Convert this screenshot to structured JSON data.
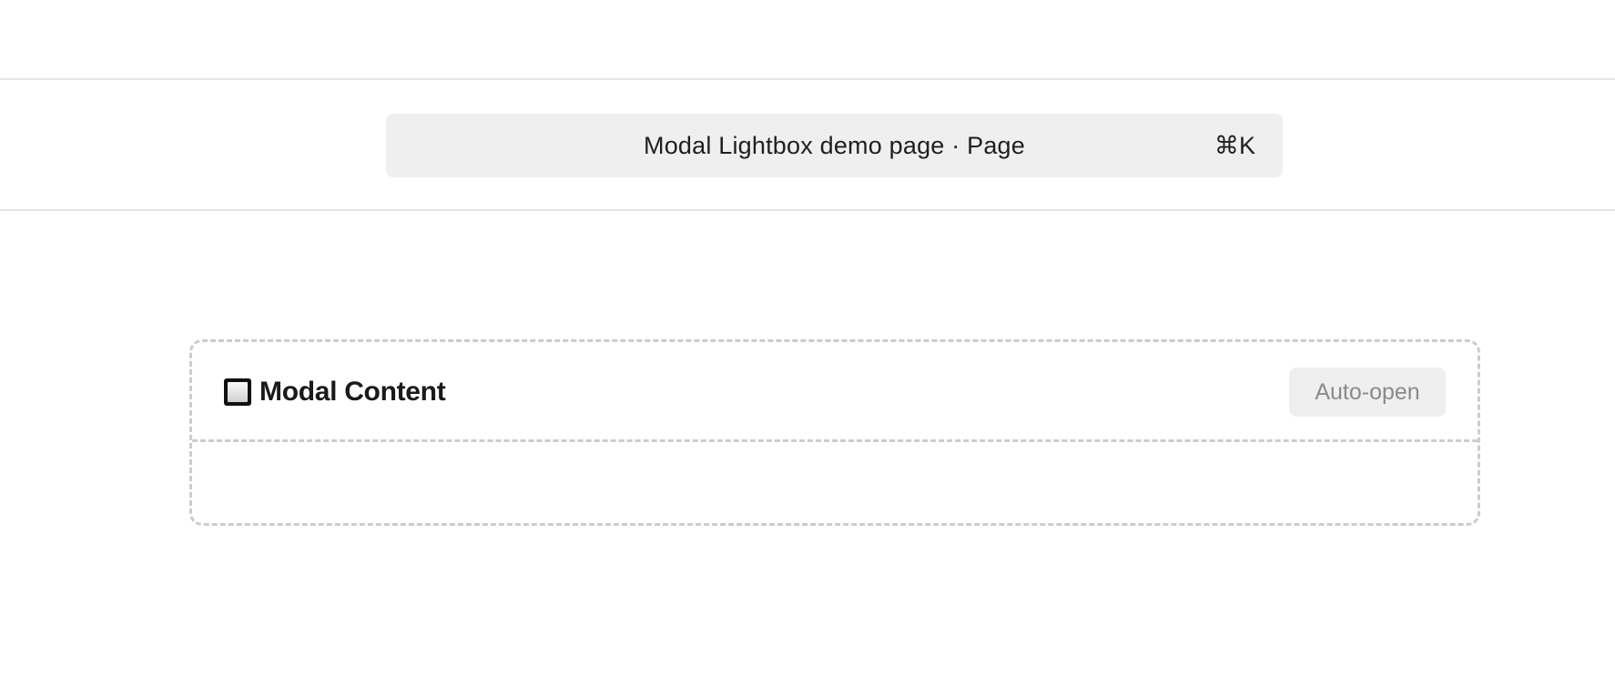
{
  "command_bar": {
    "title": "Modal Lightbox demo page · Page",
    "shortcut": "⌘K"
  },
  "modal": {
    "icon": "square-button-icon",
    "title": "Modal Content",
    "auto_open_label": "Auto-open"
  }
}
